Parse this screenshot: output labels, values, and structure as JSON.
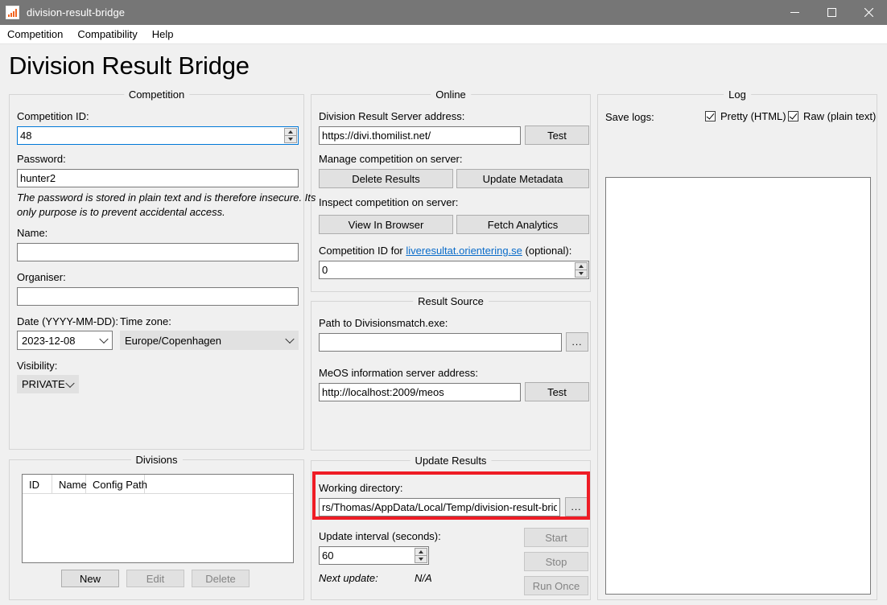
{
  "window": {
    "title": "division-result-bridge",
    "icon": "chart-bars-icon",
    "minimize": "—",
    "maximize": "□",
    "close": "✕"
  },
  "menubar": {
    "items": [
      {
        "label": "Competition"
      },
      {
        "label": "Compatibility"
      },
      {
        "label": "Help"
      }
    ]
  },
  "page": {
    "title": "Division Result Bridge"
  },
  "competition": {
    "group_title": "Competition",
    "competition_id_label": "Competition ID:",
    "competition_id_value": "48",
    "password_label": "Password:",
    "password_value": "hunter2",
    "password_note_line1": "The password is stored in plain text and is therefore insecure. Its",
    "password_note_line2": "only purpose is to prevent accidental access.",
    "name_label": "Name:",
    "name_value": "",
    "organiser_label": "Organiser:",
    "organiser_value": "",
    "date_label": "Date (YYYY-MM-DD):",
    "date_value": "2023-12-08",
    "timezone_label": "Time zone:",
    "timezone_value": "Europe/Copenhagen",
    "visibility_label": "Visibility:",
    "visibility_value": "PRIVATE"
  },
  "divisions": {
    "group_title": "Divisions",
    "columns": [
      "ID",
      "Name",
      "Config Path"
    ],
    "rows": [],
    "new_button": "New",
    "edit_button": "Edit",
    "delete_button": "Delete"
  },
  "online": {
    "group_title": "Online",
    "server_address_label": "Division Result Server address:",
    "server_address_value": "https://divi.thomilist.net/",
    "server_test_button": "Test",
    "manage_label": "Manage competition on server:",
    "delete_results_button": "Delete Results",
    "update_metadata_button": "Update Metadata",
    "inspect_label": "Inspect competition on server:",
    "view_in_browser_button": "View In Browser",
    "fetch_analytics_button": "Fetch Analytics",
    "liveresultat_label_pre": "Competition ID for ",
    "liveresultat_link": "liveresultat.orientering.se",
    "liveresultat_label_post": " (optional):",
    "liveresultat_value": "0"
  },
  "result_source": {
    "group_title": "Result Source",
    "path_label": "Path to Divisionsmatch.exe:",
    "path_value": "",
    "path_browse_button": "...",
    "meos_label": "MeOS information server address:",
    "meos_value": "http://localhost:2009/meos",
    "meos_test_button": "Test"
  },
  "update_results": {
    "group_title": "Update Results",
    "working_directory_label": "Working directory:",
    "working_directory_value": "rs/Thomas/AppData/Local/Temp/division-result-bridge",
    "working_directory_browse_button": "...",
    "update_interval_label": "Update interval (seconds):",
    "update_interval_value": "60",
    "next_update_label": "Next update:",
    "next_update_value": "N/A",
    "start_button": "Start",
    "stop_button": "Stop",
    "run_once_button": "Run Once"
  },
  "log": {
    "group_title": "Log",
    "save_logs_label": "Save logs:",
    "pretty_label": "Pretty (HTML)",
    "raw_label": "Raw (plain text)",
    "content": ""
  },
  "colors": {
    "titlebar": "#767676",
    "accent_focus": "#0078d7",
    "highlight": "#ee1c25",
    "link": "#0a6cca",
    "panel_bg": "#f0f0f0"
  }
}
